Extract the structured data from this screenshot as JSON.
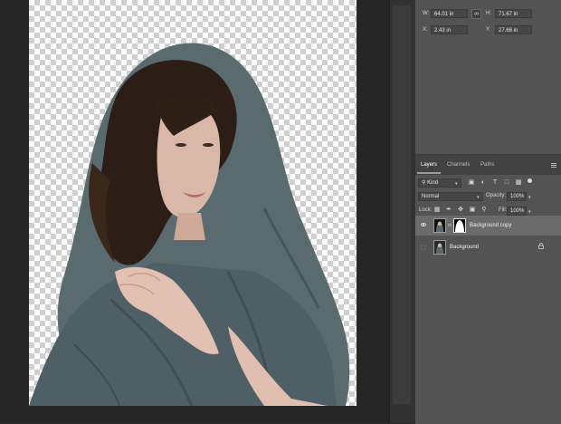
{
  "properties": {
    "w_label": "W:",
    "w_value": "64.01 in",
    "h_label": "H:",
    "h_value": "71.67 in",
    "x_label": "X:",
    "x_value": "2.43 in",
    "y_label": "Y:",
    "y_value": "27.66 in",
    "link_icon": "link-icon"
  },
  "layers_panel": {
    "tabs": [
      {
        "label": "Layers",
        "active": true
      },
      {
        "label": "Channels",
        "active": false
      },
      {
        "label": "Paths",
        "active": false
      }
    ],
    "filter": {
      "kind_label": "Kind"
    },
    "blend_mode": "Normal",
    "opacity_label": "Opacity:",
    "opacity_value": "100%",
    "lock_label": "Lock:",
    "fill_label": "Fill:",
    "fill_value": "100%",
    "layers": [
      {
        "name": "Background copy",
        "visible": true,
        "selected": true,
        "has_mask": true
      },
      {
        "name": "Background",
        "visible": false,
        "selected": false,
        "locked": true
      }
    ]
  },
  "colors": {
    "panel_bg": "#535353",
    "selected_layer": "#6b6b6b",
    "tab_bar": "#424242",
    "canvas_bg": "#262626"
  }
}
